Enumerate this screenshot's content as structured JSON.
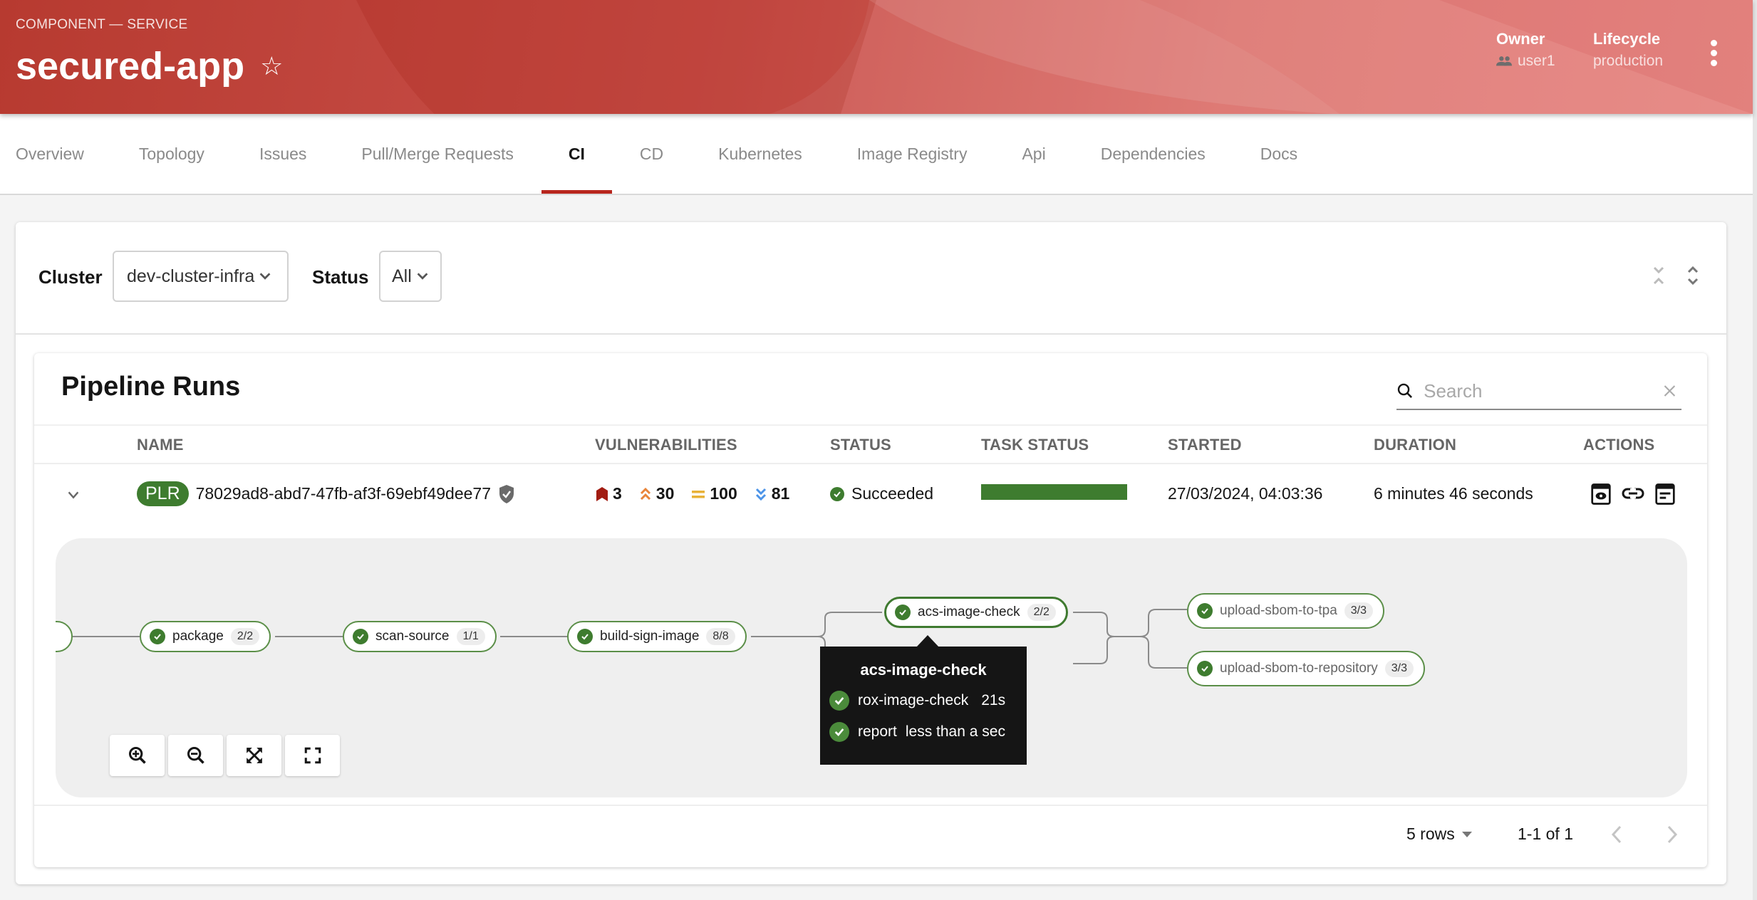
{
  "header": {
    "kind": "COMPONENT — SERVICE",
    "title": "secured-app",
    "favorite_icon": "star-outline-icon",
    "owner_label": "Owner",
    "owner_value": "user1",
    "owner_icon": "group-icon",
    "lifecycle_label": "Lifecycle",
    "lifecycle_value": "production",
    "menu_icon": "kebab-menu-icon",
    "brand_color": "#c9504a"
  },
  "tabs": [
    {
      "label": "Overview"
    },
    {
      "label": "Topology"
    },
    {
      "label": "Issues"
    },
    {
      "label": "Pull/Merge Requests"
    },
    {
      "label": "CI",
      "active": true
    },
    {
      "label": "CD"
    },
    {
      "label": "Kubernetes"
    },
    {
      "label": "Image Registry"
    },
    {
      "label": "Api"
    },
    {
      "label": "Dependencies"
    },
    {
      "label": "Docs"
    }
  ],
  "filters": {
    "cluster_label": "Cluster",
    "cluster_value": "dev-cluster-infra",
    "status_label": "Status",
    "status_value": "All",
    "collapse_all_icon": "collapse-all-icon",
    "expand_all_icon": "expand-all-icon"
  },
  "pipeline_runs": {
    "title": "Pipeline Runs",
    "search_placeholder": "Search",
    "columns": [
      "NAME",
      "VULNERABILITIES",
      "STATUS",
      "TASK STATUS",
      "STARTED",
      "DURATION",
      "ACTIONS"
    ],
    "rows": [
      {
        "badge": "PLR",
        "name": "78029ad8-abd7-47fb-af3f-69ebf49dee77",
        "signed_icon": "shield-check-icon",
        "vulnerabilities": {
          "critical": "3",
          "high": "30",
          "medium": "100",
          "low": "81"
        },
        "status": "Succeeded",
        "task_status_progress": 1.0,
        "started": "27/03/2024, 04:03:36",
        "duration": "6 minutes 46 seconds",
        "actions": [
          "view-logs-icon",
          "link-icon",
          "view-output-icon"
        ]
      }
    ],
    "colors": {
      "critical": "#a21c12",
      "high": "#e9853a",
      "medium": "#e8b238",
      "low": "#4c94e8",
      "success": "#3e7c2f"
    },
    "graph": {
      "nodes": [
        {
          "label": "package",
          "count": "2/2"
        },
        {
          "label": "scan-source",
          "count": "1/1"
        },
        {
          "label": "build-sign-image",
          "count": "8/8"
        },
        {
          "label": "acs-image-check",
          "count": "2/2"
        },
        {
          "label": "upload-sbom-to-tpa",
          "count": "3/3"
        },
        {
          "label": "upload-sbom-to-repository",
          "count": "3/3"
        }
      ],
      "tooltip": {
        "title": "acs-image-check",
        "steps": [
          {
            "name": "rox-image-check",
            "duration": "21s"
          },
          {
            "name": "report",
            "duration": "less than a sec"
          }
        ]
      },
      "controls": [
        "zoom-in-icon",
        "zoom-out-icon",
        "fit-to-screen-icon",
        "reset-view-icon"
      ]
    },
    "pagination": {
      "rows_per_page": "5 rows",
      "range": "1-1 of 1"
    }
  }
}
